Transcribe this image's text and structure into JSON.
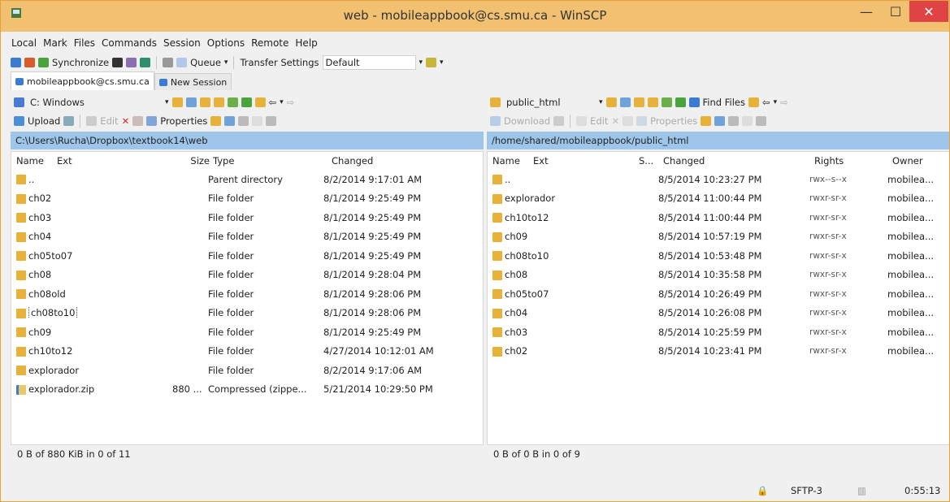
{
  "window": {
    "title": "web - mobileappbook@cs.smu.ca - WinSCP",
    "minimize": "—",
    "maximize": "☐",
    "close": "✕"
  },
  "menu": [
    "Local",
    "Mark",
    "Files",
    "Commands",
    "Session",
    "Options",
    "Remote",
    "Help"
  ],
  "toolbar": {
    "synchronize": "Synchronize",
    "queue": "Queue",
    "transfer_settings": "Transfer Settings",
    "transfer_value": "Default"
  },
  "tabs": [
    {
      "label": "mobileappbook@cs.smu.ca"
    },
    {
      "label": "New Session"
    }
  ],
  "left": {
    "drive": "C: Windows",
    "upload": "Upload",
    "edit": "Edit",
    "properties": "Properties",
    "path": "C:\\Users\\Rucha\\Dropbox\\textbook14\\web",
    "headers": {
      "name": "Name",
      "ext": "Ext",
      "size": "Size",
      "type": "Type",
      "changed": "Changed"
    },
    "rows": [
      {
        "name": "..",
        "size": "",
        "type": "Parent directory",
        "changed": "8/2/2014 9:17:01 AM"
      },
      {
        "name": "ch02",
        "size": "",
        "type": "File folder",
        "changed": "8/1/2014 9:25:49 PM"
      },
      {
        "name": "ch03",
        "size": "",
        "type": "File folder",
        "changed": "8/1/2014 9:25:49 PM"
      },
      {
        "name": "ch04",
        "size": "",
        "type": "File folder",
        "changed": "8/1/2014 9:25:49 PM"
      },
      {
        "name": "ch05to07",
        "size": "",
        "type": "File folder",
        "changed": "8/1/2014 9:25:49 PM"
      },
      {
        "name": "ch08",
        "size": "",
        "type": "File folder",
        "changed": "8/1/2014 9:28:04 PM"
      },
      {
        "name": "ch08old",
        "size": "",
        "type": "File folder",
        "changed": "8/1/2014 9:28:06 PM"
      },
      {
        "name": "ch08to10",
        "size": "",
        "type": "File folder",
        "changed": "8/1/2014 9:28:06 PM"
      },
      {
        "name": "ch09",
        "size": "",
        "type": "File folder",
        "changed": "8/1/2014 9:25:49 PM"
      },
      {
        "name": "ch10to12",
        "size": "",
        "type": "File folder",
        "changed": "4/27/2014 10:12:01 AM"
      },
      {
        "name": "explorador",
        "size": "",
        "type": "File folder",
        "changed": "8/2/2014 9:17:06 AM"
      },
      {
        "name": "explorador.zip",
        "size": "880 ...",
        "type": "Compressed (zippe...",
        "changed": "5/21/2014 10:29:50 PM"
      }
    ],
    "status": "0 B of 880 KiB in 0 of 11"
  },
  "right": {
    "folder": "public_html",
    "find_files": "Find Files",
    "download": "Download",
    "edit": "Edit",
    "properties": "Properties",
    "path": "/home/shared/mobileappbook/public_html",
    "headers": {
      "name": "Name",
      "ext": "Ext",
      "size": "S...",
      "changed": "Changed",
      "rights": "Rights",
      "owner": "Owner"
    },
    "rows": [
      {
        "name": "..",
        "changed": "8/5/2014 10:23:27 PM",
        "rights": "rwx--s--x",
        "owner": "mobilea..."
      },
      {
        "name": "explorador",
        "changed": "8/5/2014 11:00:44 PM",
        "rights": "rwxr-sr-x",
        "owner": "mobilea..."
      },
      {
        "name": "ch10to12",
        "changed": "8/5/2014 11:00:44 PM",
        "rights": "rwxr-sr-x",
        "owner": "mobilea..."
      },
      {
        "name": "ch09",
        "changed": "8/5/2014 10:57:19 PM",
        "rights": "rwxr-sr-x",
        "owner": "mobilea..."
      },
      {
        "name": "ch08to10",
        "changed": "8/5/2014 10:53:48 PM",
        "rights": "rwxr-sr-x",
        "owner": "mobilea..."
      },
      {
        "name": "ch08",
        "changed": "8/5/2014 10:35:58 PM",
        "rights": "rwxr-sr-x",
        "owner": "mobilea..."
      },
      {
        "name": "ch05to07",
        "changed": "8/5/2014 10:26:49 PM",
        "rights": "rwxr-sr-x",
        "owner": "mobilea..."
      },
      {
        "name": "ch04",
        "changed": "8/5/2014 10:26:08 PM",
        "rights": "rwxr-sr-x",
        "owner": "mobilea..."
      },
      {
        "name": "ch03",
        "changed": "8/5/2014 10:25:59 PM",
        "rights": "rwxr-sr-x",
        "owner": "mobilea..."
      },
      {
        "name": "ch02",
        "changed": "8/5/2014 10:23:41 PM",
        "rights": "rwxr-sr-x",
        "owner": "mobilea..."
      }
    ],
    "status": "0 B of 0 B in 0 of 9"
  },
  "statusbar": {
    "protocol": "SFTP-3",
    "time": "0:55:13"
  },
  "colors": {
    "titlebar": "#f1c070",
    "path_bar": "#9ec6ea",
    "close": "#e04343",
    "folder": "#e6b23c"
  }
}
